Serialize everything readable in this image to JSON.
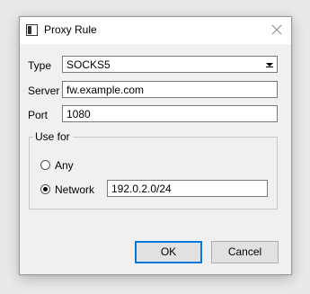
{
  "window": {
    "title": "Proxy Rule"
  },
  "form": {
    "type_label": "Type",
    "type_value": "SOCKS5",
    "server_label": "Server",
    "server_value": "fw.example.com",
    "port_label": "Port",
    "port_value": "1080"
  },
  "use_for": {
    "legend": "Use for",
    "options": [
      {
        "label": "Any",
        "checked": false
      },
      {
        "label": "Network",
        "checked": true
      }
    ],
    "network_value": "192.0.2.0/24"
  },
  "buttons": {
    "ok": "OK",
    "cancel": "Cancel"
  },
  "icons": {
    "app": "window-icon",
    "close": "close-icon",
    "dropdown": "chevron-down-icon"
  }
}
